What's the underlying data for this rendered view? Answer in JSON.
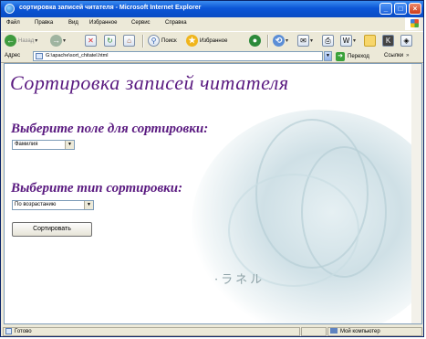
{
  "window": {
    "title": "сортировка записей читателя - Microsoft Internet Explorer"
  },
  "menu": [
    "Файл",
    "Правка",
    "Вид",
    "Избранное",
    "Сервис",
    "Справка"
  ],
  "toolbar": {
    "back": "Назад",
    "search": "Поиск",
    "favorites": "Избранное"
  },
  "address": {
    "label": "Адрес",
    "value": "G:\\apache\\sort_chitatel.html",
    "go": "Переход",
    "links": "Ссылки"
  },
  "page": {
    "heading": "Сортировка записей читателя",
    "field_label": "Выберите поле для сортировки:",
    "field_select": "Фамилия",
    "type_label": "Выберите тип сортировки:",
    "type_select": "По возрастанию",
    "sort_button": "Сортировать",
    "bg_text": "·ラネル"
  },
  "status": {
    "left": "Готово",
    "right": "Мой компьютер"
  }
}
